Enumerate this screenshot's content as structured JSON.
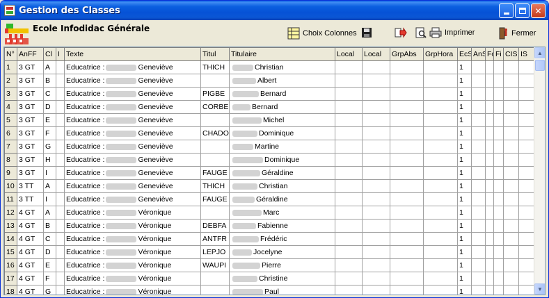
{
  "window": {
    "title": "Gestion des Classes"
  },
  "header": {
    "school_name": "Ecole Infodidac Générale"
  },
  "toolbar": {
    "choix_colonnes": "Choix Colonnes",
    "imprimer": "Imprimer",
    "fermer": "Fermer"
  },
  "columns": [
    "N°",
    "AnFF",
    "Cl",
    "I",
    "Texte",
    "Titul",
    "Titulaire",
    "Local",
    "Local",
    "GrpAbs",
    "GrpHora",
    "EcS",
    "AnS",
    "Fo",
    "Fi",
    "CIS",
    "IS"
  ],
  "rows": [
    {
      "n": "1",
      "anff": "3 GT",
      "cl": "A",
      "texte": "Educatrice :",
      "texte_name": "Geneviève",
      "titul": "THICH",
      "titulaire": "Christian",
      "ecs": "1"
    },
    {
      "n": "2",
      "anff": "3 GT",
      "cl": "B",
      "texte": "Educatrice :",
      "texte_name": "Geneviève",
      "titul": "",
      "titulaire": "Albert",
      "ecs": "1"
    },
    {
      "n": "3",
      "anff": "3 GT",
      "cl": "C",
      "texte": "Educatrice :",
      "texte_name": "Geneviève",
      "titul": "PIGBE",
      "titulaire": "Bernard",
      "ecs": "1"
    },
    {
      "n": "4",
      "anff": "3 GT",
      "cl": "D",
      "texte": "Educatrice :",
      "texte_name": "Geneviève",
      "titul": "CORBE",
      "titulaire": "Bernard",
      "ecs": "1"
    },
    {
      "n": "5",
      "anff": "3 GT",
      "cl": "E",
      "texte": "Educatrice :",
      "texte_name": "Geneviève",
      "titul": "",
      "titulaire": "Michel",
      "ecs": "1"
    },
    {
      "n": "6",
      "anff": "3 GT",
      "cl": "F",
      "texte": "Educatrice :",
      "texte_name": "Geneviève",
      "titul": "CHADO",
      "titulaire": "Dominique",
      "ecs": "1"
    },
    {
      "n": "7",
      "anff": "3 GT",
      "cl": "G",
      "texte": "Educatrice :",
      "texte_name": "Geneviève",
      "titul": "",
      "titulaire": "Martine",
      "ecs": "1"
    },
    {
      "n": "8",
      "anff": "3 GT",
      "cl": "H",
      "texte": "Educatrice :",
      "texte_name": "Geneviève",
      "titul": "",
      "titulaire": "Dominique",
      "ecs": "1"
    },
    {
      "n": "9",
      "anff": "3 GT",
      "cl": "I",
      "texte": "Educatrice :",
      "texte_name": "Geneviève",
      "titul": "FAUGE",
      "titulaire": "Géraldine",
      "ecs": "1"
    },
    {
      "n": "10",
      "anff": "3 TT",
      "cl": "A",
      "texte": "Educatrice :",
      "texte_name": "Geneviève",
      "titul": "THICH",
      "titulaire": "Christian",
      "ecs": "1"
    },
    {
      "n": "11",
      "anff": "3 TT",
      "cl": "I",
      "texte": "Educatrice :",
      "texte_name": "Geneviève",
      "titul": "FAUGE",
      "titulaire": "Géraldine",
      "ecs": "1"
    },
    {
      "n": "12",
      "anff": "4 GT",
      "cl": "A",
      "texte": "Educatrice :",
      "texte_name": "Véronique",
      "titul": "",
      "titulaire": "Marc",
      "ecs": "1"
    },
    {
      "n": "13",
      "anff": "4 GT",
      "cl": "B",
      "texte": "Educatrice :",
      "texte_name": "Véronique",
      "titul": "DEBFA",
      "titulaire": "Fabienne",
      "ecs": "1"
    },
    {
      "n": "14",
      "anff": "4 GT",
      "cl": "C",
      "texte": "Educatrice :",
      "texte_name": "Véronique",
      "titul": "ANTFR",
      "titulaire": "Frédéric",
      "ecs": "1"
    },
    {
      "n": "15",
      "anff": "4 GT",
      "cl": "D",
      "texte": "Educatrice :",
      "texte_name": "Véronique",
      "titul": "LEPJO",
      "titulaire": "Jocelyne",
      "ecs": "1"
    },
    {
      "n": "16",
      "anff": "4 GT",
      "cl": "E",
      "texte": "Educatrice :",
      "texte_name": "Véronique",
      "titul": "WAUPI",
      "titulaire": "Pierre",
      "ecs": "1"
    },
    {
      "n": "17",
      "anff": "4 GT",
      "cl": "F",
      "texte": "Educatrice :",
      "texte_name": "Véronique",
      "titul": "",
      "titulaire": "Christine",
      "ecs": "1"
    },
    {
      "n": "18",
      "anff": "4 GT",
      "cl": "G",
      "texte": "Educatrice :",
      "texte_name": "Véronique",
      "titul": "",
      "titulaire": "Paul",
      "ecs": "1"
    }
  ]
}
